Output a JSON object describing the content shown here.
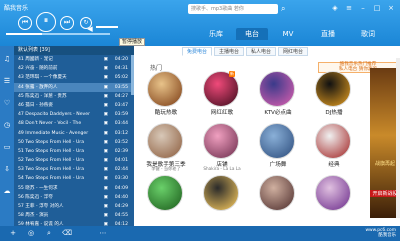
{
  "app": {
    "title": "酷我音乐"
  },
  "search": {
    "placeholder": "搜歌手、mp3歌曲 若你"
  },
  "tooltip": "暂停播放",
  "nav_tabs": [
    {
      "label": "乐库"
    },
    {
      "label": "电台"
    },
    {
      "label": "MV"
    },
    {
      "label": "直播"
    },
    {
      "label": "歌词"
    }
  ],
  "playlist": {
    "header": "默认列表 [39]",
    "rows": [
      {
        "title": "41 周國新 - 宠记",
        "duration": "04:20"
      },
      {
        "title": "42 兴奋 - 随的前前",
        "duration": "04:31"
      },
      {
        "title": "43 范玮琪 - 一个像夏天",
        "duration": "05:02"
      },
      {
        "title": "44 张露 - 放弃的人",
        "duration": "03:55"
      },
      {
        "title": "45 陈奕迅 - 洋葱 - 贵苏",
        "duration": "04:27"
      },
      {
        "title": "46 孤日 - 孙燕姿",
        "duration": "03:47"
      },
      {
        "title": "47 Despacito Daddyers - Never",
        "duration": "03:59"
      },
      {
        "title": "48 Don't Never - Vocil - The",
        "duration": "03:44"
      },
      {
        "title": "49 Immediate Music - Avenger",
        "duration": "03:12"
      },
      {
        "title": "50 Two Steps From Hell - Ura",
        "duration": "03:52"
      },
      {
        "title": "51 Two Steps From Hell - Ura",
        "duration": "02:39"
      },
      {
        "title": "52 Two Steps From Hell - Ura",
        "duration": "04:01"
      },
      {
        "title": "53 Two Steps From Hell - Ura",
        "duration": "02:44"
      },
      {
        "title": "54 Two Steps From Hell - Ura",
        "duration": "03:30"
      },
      {
        "title": "55 晓苏 - 一生何求",
        "duration": "04:09"
      },
      {
        "title": "56 陈奕迅 - 浮夸",
        "duration": "04:40"
      },
      {
        "title": "57 王菲 - 浮夸 对的人",
        "duration": "04:29"
      },
      {
        "title": "58 周杰 - 演员",
        "duration": "04:55"
      },
      {
        "title": "59 林宥嘉 - 说谎 的人",
        "duration": "04:12"
      }
    ]
  },
  "radio": {
    "subtabs": [
      {
        "label": "免费电台"
      },
      {
        "label": "主播电台"
      },
      {
        "label": "私人电台"
      },
      {
        "label": "网红电台"
      }
    ],
    "section_title": "热门",
    "promo": "酷我音乐热门推荐\n私人电台 猜你喜欢",
    "tiles": [
      {
        "label": "酷玩热歌",
        "sub": ""
      },
      {
        "label": "网红红歌",
        "sub": ""
      },
      {
        "label": "KTV必点曲",
        "sub": ""
      },
      {
        "label": "DJ热播",
        "sub": ""
      },
      {
        "label": "我是歌手第三季",
        "sub": "李健 - 当你老了"
      },
      {
        "label": "店铺",
        "sub": "Shakira - La La La"
      },
      {
        "label": "广场舞",
        "sub": ""
      },
      {
        "label": "经典",
        "sub": ""
      },
      {
        "label": "",
        "sub": ""
      },
      {
        "label": "",
        "sub": ""
      },
      {
        "label": "",
        "sub": ""
      },
      {
        "label": "",
        "sub": ""
      }
    ],
    "new_badge": "新"
  },
  "ad": {
    "line1": "战旗再起",
    "line2": "开启新战役"
  },
  "watermark": {
    "line1": "www.pc6.com",
    "line2": "酷我音乐"
  }
}
